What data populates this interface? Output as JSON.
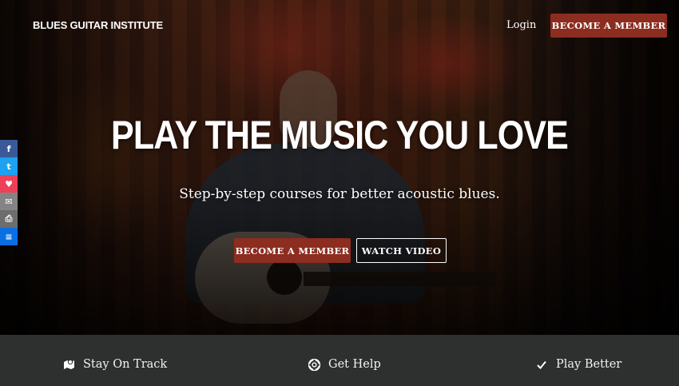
{
  "header": {
    "brand": "BLUES GUITAR INSTITUTE",
    "login_label": "Login",
    "cta_label": "BECOME A MEMBER"
  },
  "hero": {
    "headline": "PLAY THE MUSIC YOU LOVE",
    "subheadline": "Step-by-step courses for better acoustic blues.",
    "primary_button": "BECOME A MEMBER",
    "secondary_button": "WATCH VIDEO"
  },
  "share_bar": [
    {
      "icon": "facebook-icon",
      "glyph": "f",
      "color": "#3b5998"
    },
    {
      "icon": "twitter-icon",
      "glyph": "t",
      "color": "#1da1f2"
    },
    {
      "icon": "pocket-icon",
      "glyph": "♥",
      "color": "#ee4056"
    },
    {
      "icon": "email-icon",
      "glyph": "✉",
      "color": "#848484"
    },
    {
      "icon": "print-icon",
      "glyph": "⎙",
      "color": "#6d6d6d"
    },
    {
      "icon": "sumo-icon",
      "glyph": "≡",
      "color": "#0b6fe4"
    }
  ],
  "features": [
    {
      "icon": "map-icon",
      "label": "Stay On Track"
    },
    {
      "icon": "support-icon",
      "label": "Get Help"
    },
    {
      "icon": "check-icon",
      "label": "Play Better"
    }
  ],
  "colors": {
    "accent": "#8c2d1f",
    "features_bg": "#2e302f"
  }
}
